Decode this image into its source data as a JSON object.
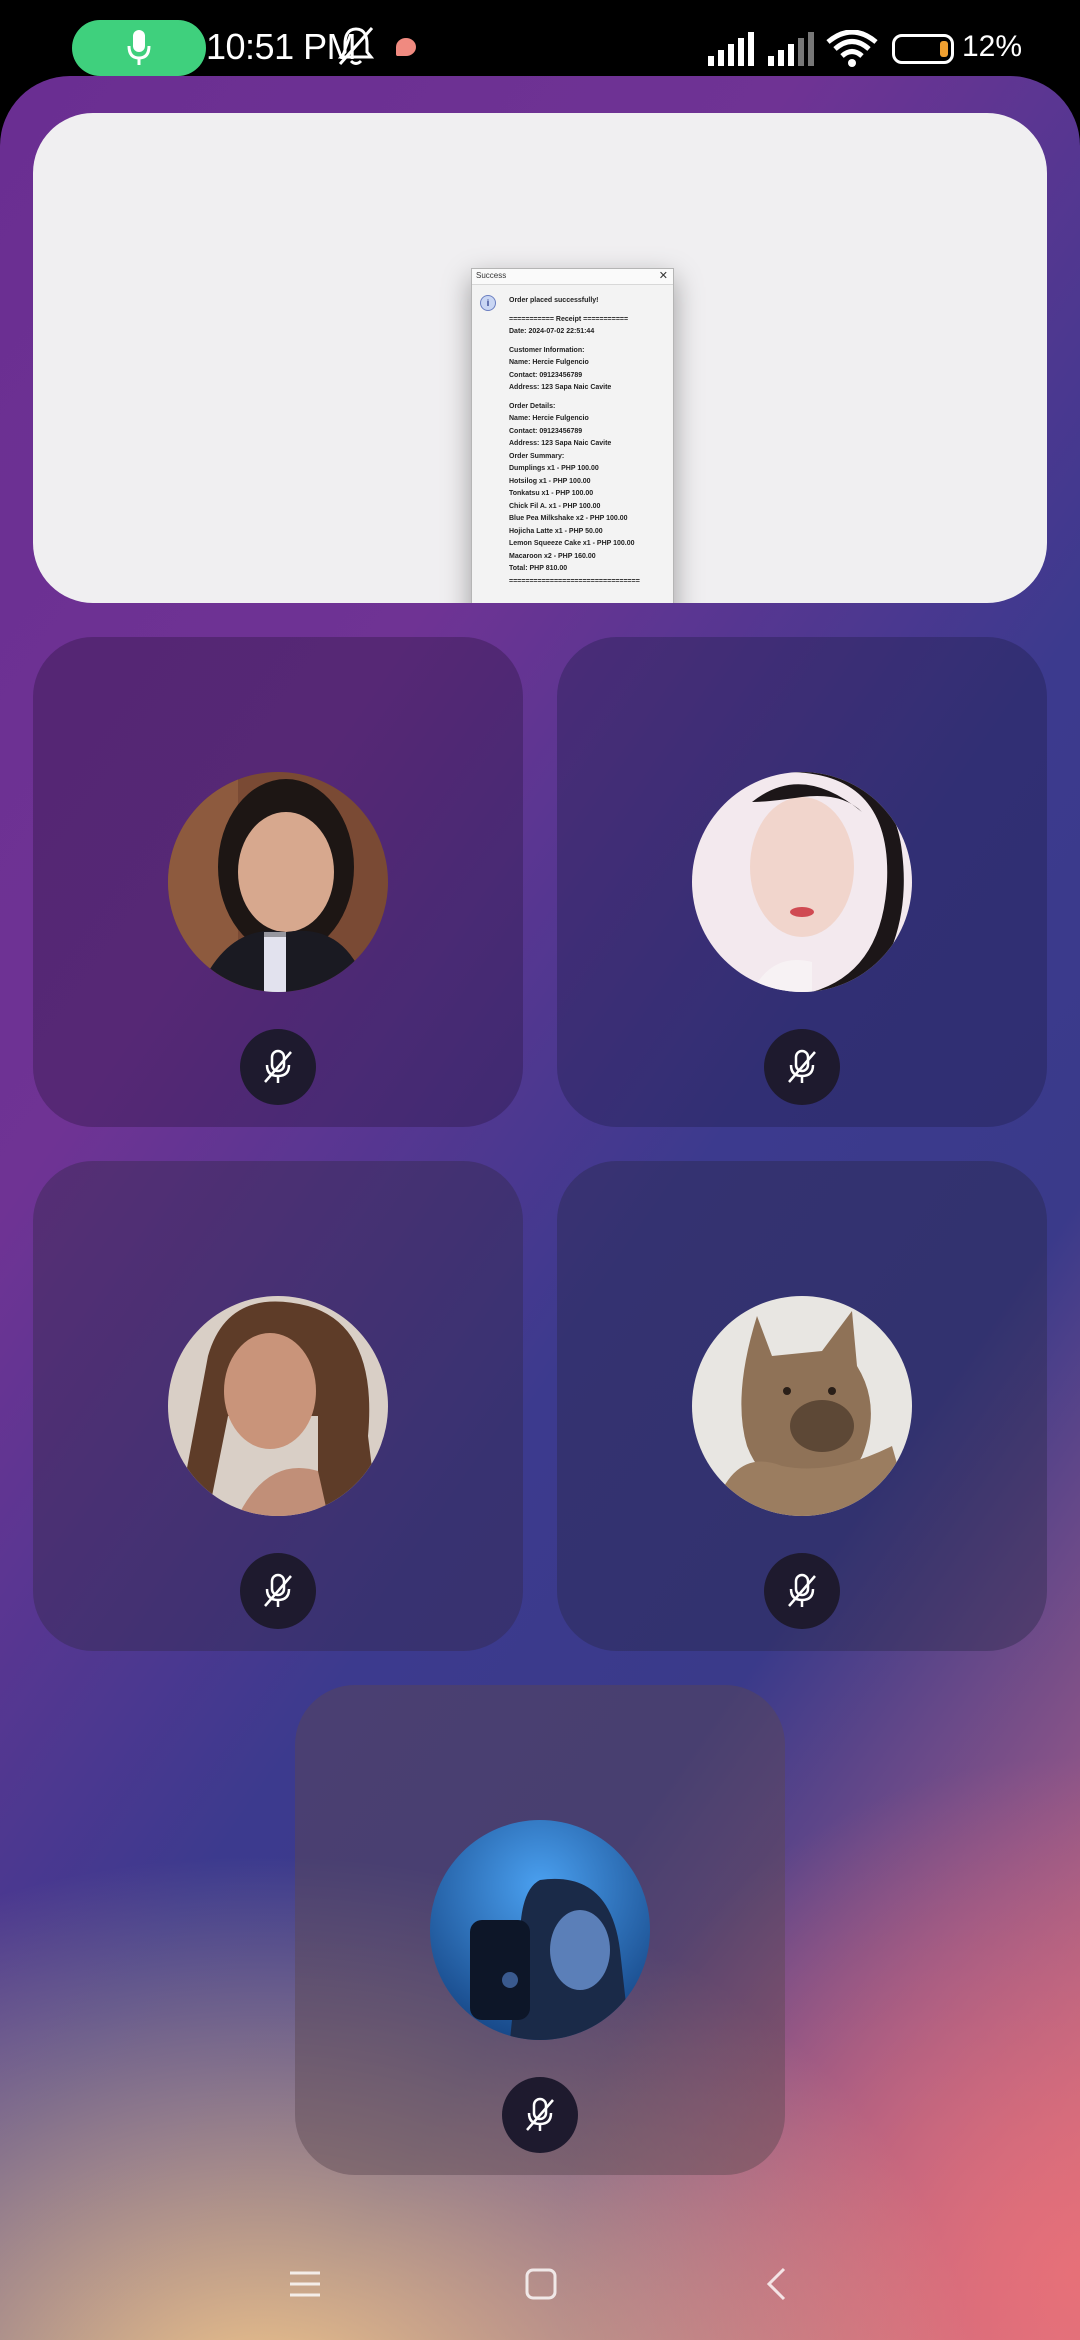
{
  "status_bar": {
    "time": "10:51 PM",
    "battery_percent": "12%",
    "battery_level": 0.12,
    "icons": [
      "mic-icon",
      "bell-muted-icon",
      "chat-bubble-icon",
      "signal-icon",
      "signal-icon",
      "wifi-icon",
      "battery-icon"
    ]
  },
  "screen_share": {
    "dialog": {
      "title": "Success",
      "message": "Order placed successfully!",
      "receipt_header": "=========== Receipt ===========",
      "date": "Date: 2024-07-02 22:51:44",
      "customer_header": "Customer Information:",
      "customer_name": "Name: Hercie Fulgencio",
      "customer_contact": "Contact: 09123456789",
      "customer_address": "Address: 123 Sapa Naic Cavite",
      "order_header": "Order Details:",
      "order_name": "Name: Hercie Fulgencio",
      "order_contact": "Contact: 09123456789",
      "order_address": "Address: 123 Sapa Naic Cavite",
      "summary_header": "Order Summary:",
      "items": [
        "Dumplings x1 - PHP 100.00",
        "Hotsilog x1 - PHP 100.00",
        "Tonkatsu x1 - PHP 100.00",
        "Chick Fil A. x1 - PHP 100.00",
        "Blue Pea Milkshake x2 - PHP 100.00",
        "Hojicha Latte x1 - PHP 50.00",
        "Lemon Squeeze Cake x1 - PHP 100.00",
        "Macaroon x2 - PHP 160.00"
      ],
      "total": "Total: PHP 810.00",
      "footer_rule": "================================"
    }
  },
  "participants": [
    {
      "id": 1,
      "muted": true
    },
    {
      "id": 2,
      "muted": true
    },
    {
      "id": 3,
      "muted": true
    },
    {
      "id": 4,
      "muted": true
    },
    {
      "id": 5,
      "muted": true
    }
  ],
  "nav_bar": {
    "buttons": [
      "menu-icon",
      "home-icon",
      "back-icon"
    ]
  }
}
